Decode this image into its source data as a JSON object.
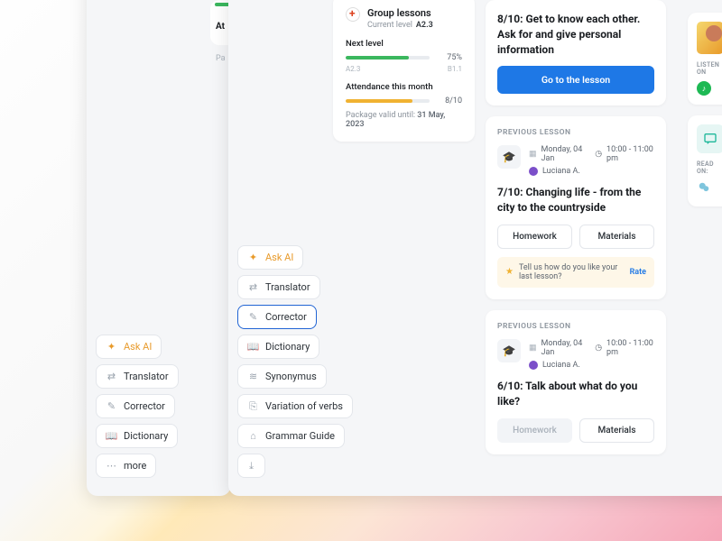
{
  "toolsets": {
    "small": [
      {
        "key": "ask-ai",
        "label": "Ask AI",
        "icon": "✦",
        "ai": true
      },
      {
        "key": "translator",
        "label": "Translator",
        "icon": "⇄"
      },
      {
        "key": "corrector",
        "label": "Corrector",
        "icon": "✎"
      },
      {
        "key": "dictionary",
        "label": "Dictionary",
        "icon": "📖"
      },
      {
        "key": "more",
        "label": "more",
        "icon": "⋯"
      }
    ],
    "large": [
      {
        "key": "ask-ai",
        "label": "Ask AI",
        "icon": "✦",
        "ai": true
      },
      {
        "key": "translator",
        "label": "Translator",
        "icon": "⇄"
      },
      {
        "key": "corrector",
        "label": "Corrector",
        "icon": "✎",
        "selected": true
      },
      {
        "key": "dictionary",
        "label": "Dictionary",
        "icon": "📖"
      },
      {
        "key": "synonymus",
        "label": "Synonymus",
        "icon": "≋"
      },
      {
        "key": "variation",
        "label": "Variation of verbs",
        "icon": "⎘"
      },
      {
        "key": "grammar",
        "label": "Grammar Guide",
        "icon": "⌂"
      },
      {
        "key": "download",
        "label": "",
        "icon": "⤓",
        "iconOnly": true
      }
    ]
  },
  "progress": {
    "title": "Group lessons",
    "current_label": "Current level",
    "current_value": "A2.3",
    "next_label": "Next level",
    "next_pct": "75%",
    "tick_from": "A2.3",
    "tick_to": "B1.1",
    "attendance_label": "Attendance this month",
    "attendance_value": "8/10",
    "footer_prefix": "Package valid until: ",
    "footer_date": "31 May, 2023"
  },
  "lessons": {
    "next": {
      "title": "8/10: Get to know each other. Ask for and give personal information",
      "cta": "Go to the lesson"
    },
    "prev1": {
      "section": "PREVIOUS LESSON",
      "date": "Monday, 04 Jan",
      "time": "10:00 - 11:00 pm",
      "teacher": "Luciana A.",
      "title": "7/10: Changing life - from the city to the countryside",
      "hw": "Homework",
      "mat": "Materials",
      "rate_prompt": "Tell us how do you like your last lesson?",
      "rate_link": "Rate"
    },
    "prev2": {
      "section": "PREVIOUS LESSON",
      "date": "Monday, 04 Jan",
      "time": "10:00 - 11:00 pm",
      "teacher": "Luciana A.",
      "title": "6/10: Talk about what do you like?",
      "hw": "Homework",
      "mat": "Materials"
    }
  },
  "side": {
    "listen": "LISTEN ON",
    "read": "READ ON:"
  },
  "stub": {
    "att": "At",
    "pac": "Pa"
  }
}
